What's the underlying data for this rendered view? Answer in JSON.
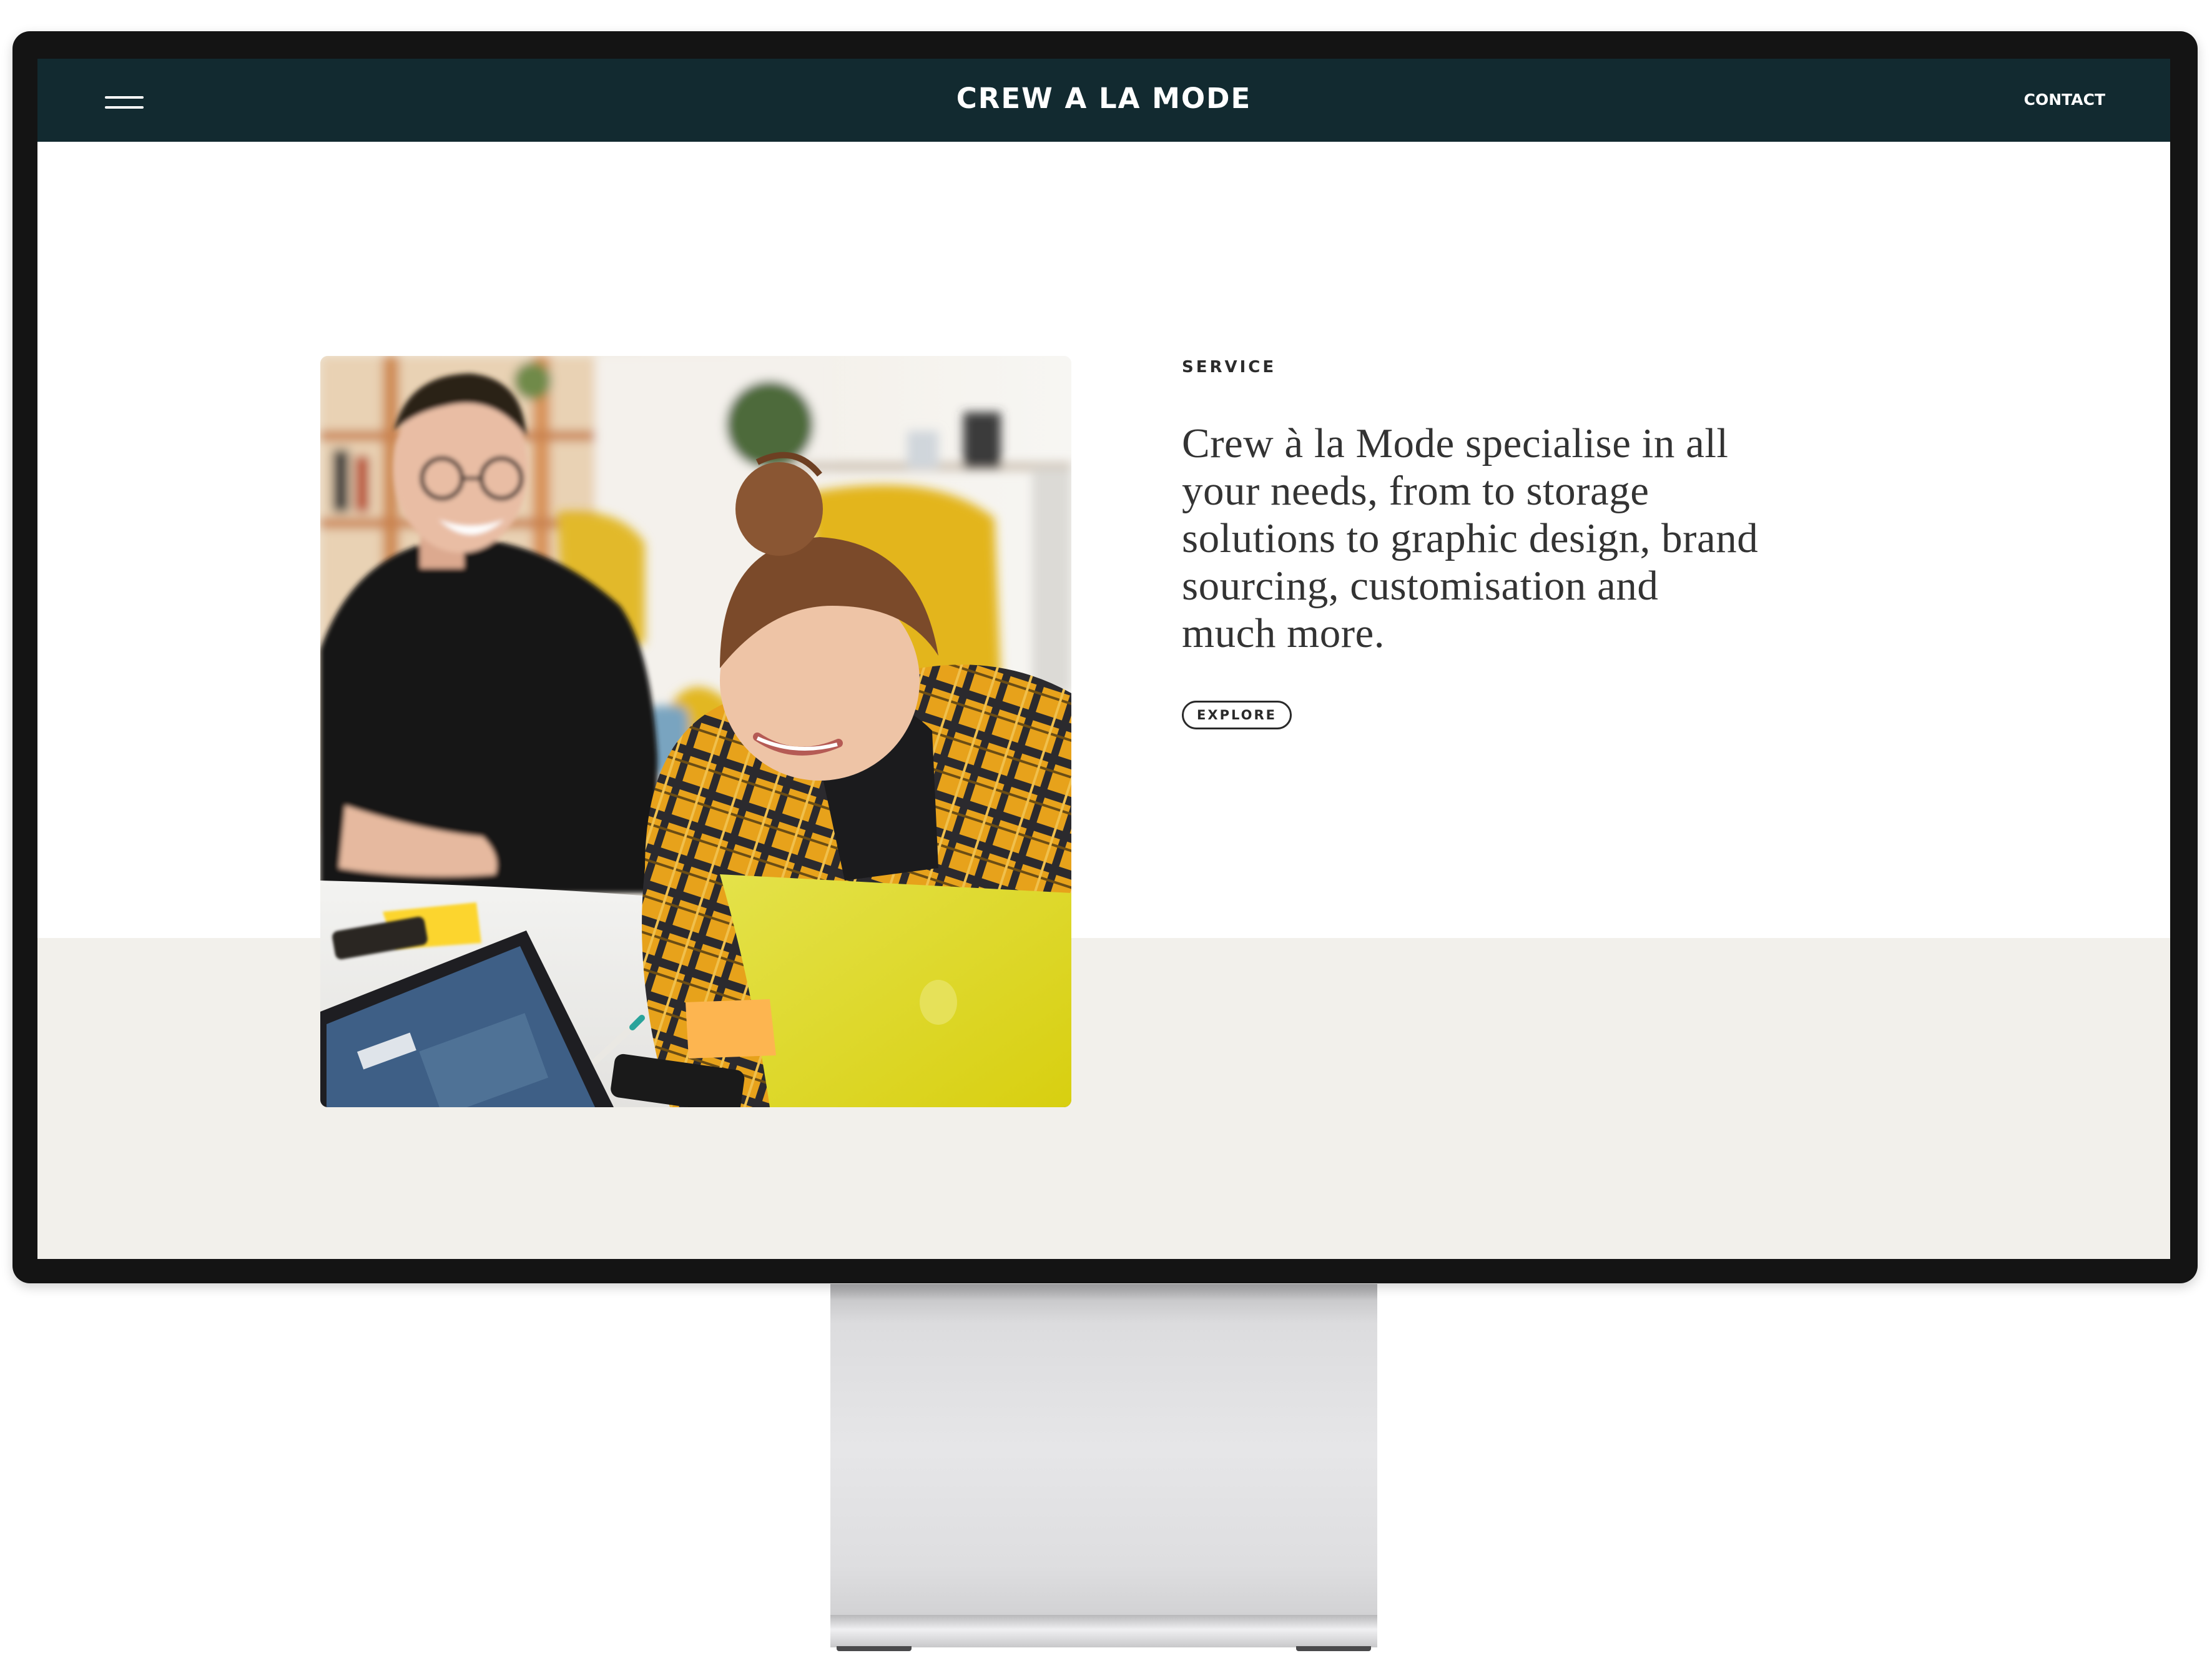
{
  "header": {
    "brand": "CREW A LA MODE",
    "contact_label": "CONTACT"
  },
  "service": {
    "eyebrow": "SERVICE",
    "description": "Crew à la Mode specialise in all your needs, from to storage solutions to graphic design, brand sourcing, customisation and much more.",
    "explore_label": "EXPLORE"
  },
  "colors": {
    "header_bg": "#122a30",
    "beige_band": "#f2f0eb",
    "text_dark": "#333333"
  }
}
